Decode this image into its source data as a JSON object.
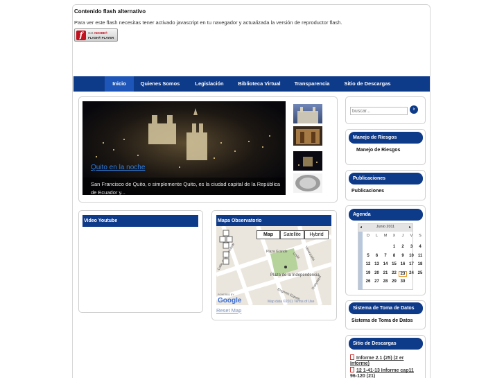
{
  "flash": {
    "title": "Contenido flash alternativo",
    "message": "Para ver este flash necesitas tener activado javascript en tu navegador y actualizada la versión de reproductor flash.",
    "badge_line1": "Get",
    "badge_brand": "ADOBE®",
    "badge_line2": "FLASH® PLAYER"
  },
  "nav": {
    "items": [
      {
        "label": "Inicio",
        "active": true
      },
      {
        "label": "Quienes Somos"
      },
      {
        "label": "Legislación"
      },
      {
        "label": "Biblioteca Virtual"
      },
      {
        "label": "Transparencia"
      },
      {
        "label": "Sitio de Descargas"
      }
    ]
  },
  "slider": {
    "title": "Quito en la noche",
    "description": "San Francisco de Quito, o simplemente Quito, es la ciudad capital de la República de Ecuador y..."
  },
  "video": {
    "header": "Video Youtube"
  },
  "map": {
    "header": "Mapa Observatorio",
    "types": [
      "Map",
      "Satellite",
      "Hybrid"
    ],
    "selected_type": "Map",
    "labels": {
      "street1": "Calle de Benalcázar",
      "street2": "Chile",
      "street3": "Venezuela",
      "street4": "Eugenio Espejo",
      "street5": "Guayaquil",
      "plaza1": "Plaza Grande",
      "plaza2": "Plaza de la Independencia"
    },
    "google": "Google",
    "powered_by": "POWERED BY",
    "attribution": "Map data ©2011 Terms of Use",
    "reset": "Reset Map"
  },
  "sidebar": {
    "search_placeholder": "buscar...",
    "search_button": "Ir",
    "sections": [
      {
        "header": "Manejo de Riesgos",
        "link": "Manejo de Riesgos"
      },
      {
        "header": "Publicaciones",
        "link": "Publicaciones"
      },
      {
        "header": "Agenda"
      },
      {
        "header": "Sistema de Toma de Datos",
        "link": "Sistema de Toma de Datos"
      },
      {
        "header": "Sitio de Descargas"
      }
    ],
    "downloads": [
      "Informe 2.1 (25) (2 er Informe)",
      "12 1-41-13 Informe cap11 96-120 (21)"
    ]
  },
  "calendar": {
    "month": "Junio 2011",
    "prev": "◂",
    "next": "▸",
    "dow": [
      "D",
      "L",
      "M",
      "X",
      "J",
      "V",
      "S"
    ],
    "weeks": [
      [
        "",
        "",
        "",
        "1",
        "2",
        "3",
        "4"
      ],
      [
        "5",
        "6",
        "7",
        "8",
        "9",
        "10",
        "11"
      ],
      [
        "12",
        "13",
        "14",
        "15",
        "16",
        "17",
        "18"
      ],
      [
        "19",
        "20",
        "21",
        "22",
        "23",
        "24",
        "25"
      ],
      [
        "26",
        "27",
        "28",
        "29",
        "30",
        "",
        ""
      ]
    ],
    "today": "23"
  }
}
